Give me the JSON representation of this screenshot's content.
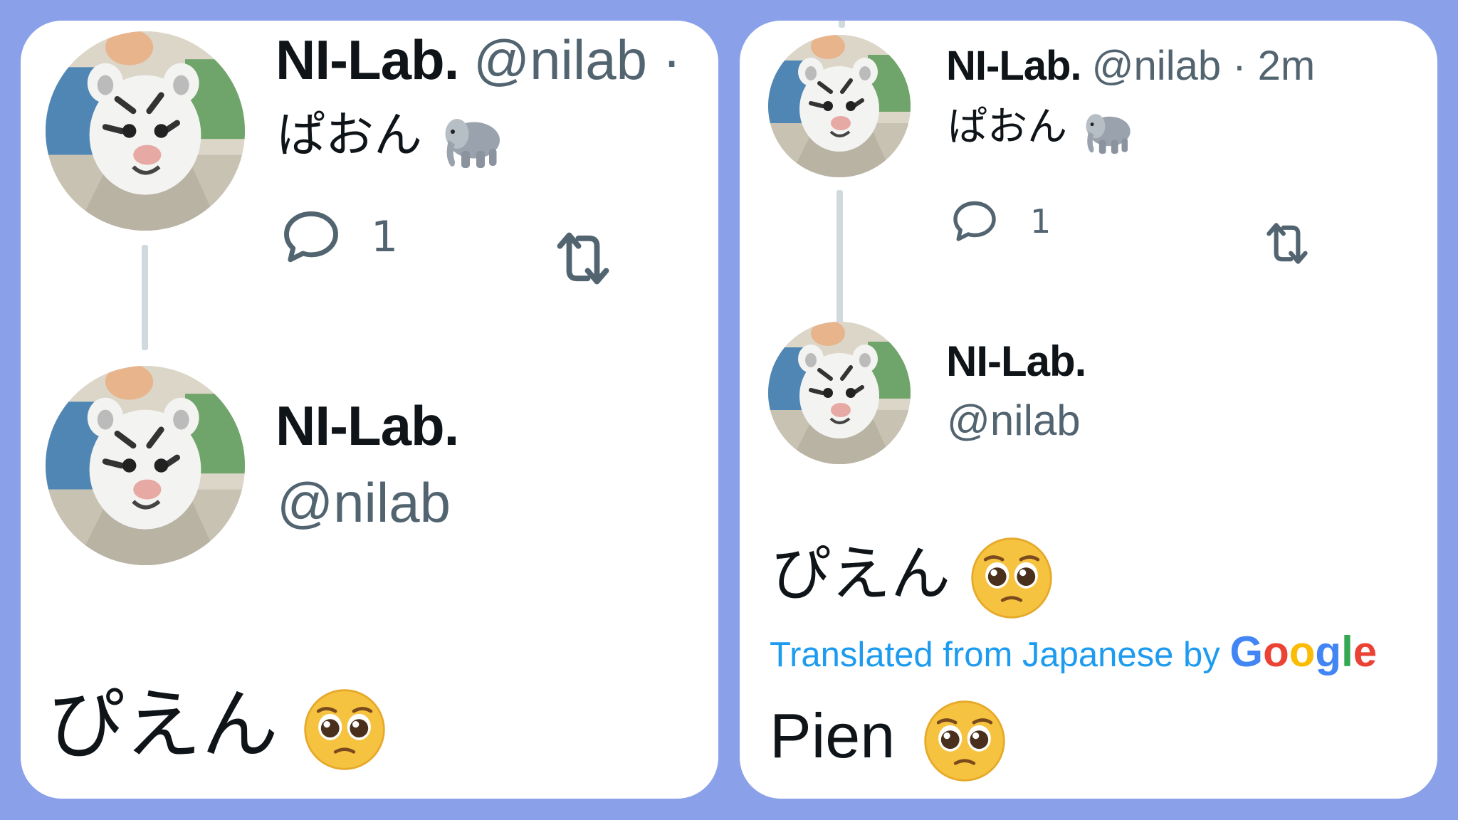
{
  "left_panel": {
    "tweet1": {
      "name": "NI-Lab.",
      "handle_meta": "@nilab ·",
      "text": "ぱおん",
      "emoji_icon": "elephant-icon",
      "reply_count": "1"
    },
    "tweet2": {
      "name": "NI-Lab.",
      "handle": "@nilab",
      "text": "ぴえん",
      "emoji_icon": "pleading-face-icon"
    }
  },
  "right_panel": {
    "tweet1": {
      "name": "NI-Lab.",
      "handle_meta": "@nilab · 2m",
      "text": "ぱおん",
      "emoji_icon": "elephant-icon",
      "reply_count": "1"
    },
    "tweet2": {
      "name": "NI-Lab.",
      "handle": "@nilab",
      "text": "ぴえん",
      "emoji_icon": "pleading-face-icon",
      "translated_label": "Translated from Japanese by",
      "google_brand": "Google",
      "translation": "Pien"
    }
  },
  "colors": {
    "background": "#8aa1ea",
    "panel": "#ffffff",
    "link_blue": "#1d9bf0",
    "secondary_text": "#536471",
    "thread_line": "#cfd9de"
  }
}
